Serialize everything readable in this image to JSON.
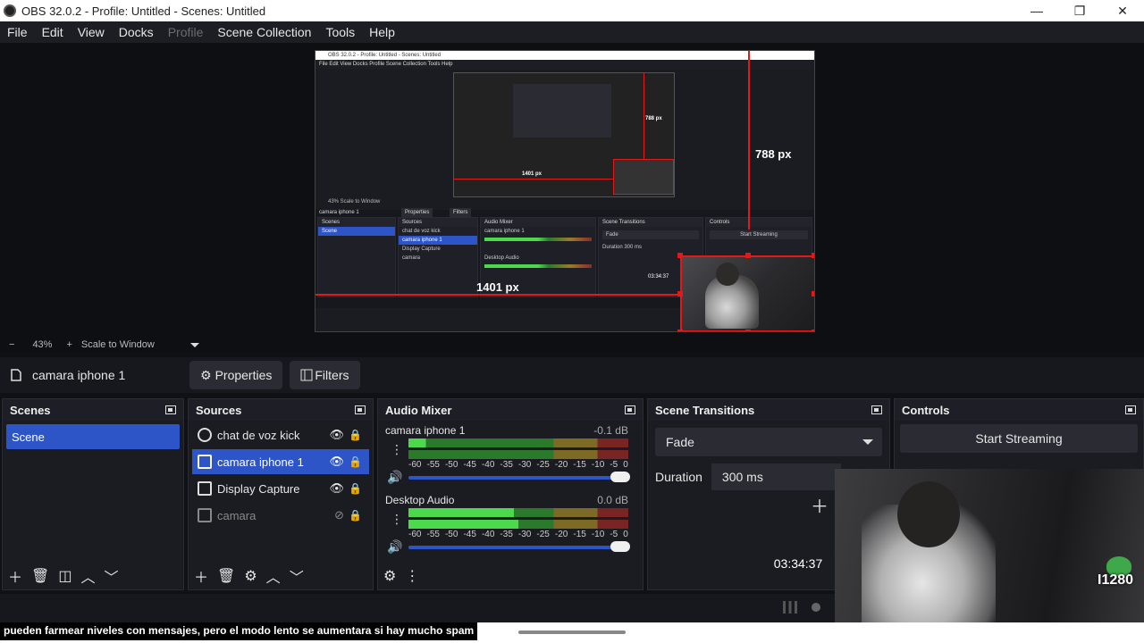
{
  "window": {
    "title": "OBS 32.0.2 - Profile: Untitled - Scenes: Untitled",
    "minimize": "—",
    "maximize": "❐",
    "close": "✕"
  },
  "menu": [
    "File",
    "Edit",
    "View",
    "Docks",
    "Profile",
    "Scene Collection",
    "Tools",
    "Help"
  ],
  "preview": {
    "measure_vertical": "788 px",
    "measure_horizontal": "1401 px",
    "mini_title": "OBS 32.0.2 - Profile: Untitled - Scenes: Untitled",
    "mini_menu": "File  Edit  View  Docks  Profile  Scene Collection  Tools  Help",
    "mini_measure_v": "788 px",
    "mini_measure_h": "1401 px",
    "mini_timer": "03:34:37",
    "mini_zoom": "43%   Scale to Window",
    "mini_source_name": "camara iphone 1",
    "mini_props": "Properties",
    "mini_filters": "Filters",
    "mini_scenes_header": "Scenes",
    "mini_scene": "Scene",
    "mini_sources_header": "Sources",
    "mini_sources": [
      "chat de voz kick",
      "camara iphone 1",
      "Display Capture",
      "camara"
    ],
    "mini_mixer_header": "Audio Mixer",
    "mini_mixer_ch1": "camara iphone 1",
    "mini_mixer_ch2": "Desktop Audio",
    "mini_trans_header": "Scene Transitions",
    "mini_trans_value": "Fade",
    "mini_duration": "Duration   300 ms",
    "mini_controls_header": "Controls",
    "mini_start": "Start Streaming"
  },
  "zoom": {
    "minus": "−",
    "level": "43%",
    "plus": "+",
    "mode": "Scale to Window"
  },
  "source_toolbar": {
    "name": "camara iphone 1",
    "properties": "Properties",
    "filters": "Filters"
  },
  "scenes": {
    "header": "Scenes",
    "items": [
      "Scene"
    ]
  },
  "sources": {
    "header": "Sources",
    "items": [
      {
        "label": "chat de voz kick",
        "icon": "globe-icon",
        "visible": true
      },
      {
        "label": "camara iphone 1",
        "icon": "file-icon",
        "visible": true
      },
      {
        "label": "Display Capture",
        "icon": "monitor-icon",
        "visible": true
      },
      {
        "label": "camara",
        "icon": "video-icon",
        "visible": false
      }
    ]
  },
  "mixer": {
    "header": "Audio Mixer",
    "channels": [
      {
        "name": "camara iphone 1",
        "db": "-0.1 dB"
      },
      {
        "name": "Desktop Audio",
        "db": "0.0 dB"
      }
    ],
    "ticks": [
      "-60",
      "-55",
      "-50",
      "-45",
      "-40",
      "-35",
      "-30",
      "-25",
      "-20",
      "-15",
      "-10",
      "-5",
      "0"
    ]
  },
  "transitions": {
    "header": "Scene Transitions",
    "selected": "Fade",
    "duration_label": "Duration",
    "duration_value": "300 ms"
  },
  "controls": {
    "header": "Controls",
    "start_streaming": "Start Streaming"
  },
  "status": {
    "timer": "03:34:37"
  },
  "overlay": {
    "caption": "pueden farmear niveles con mensajes, pero el modo lento se aumentara si hay mucho spam",
    "badge_text": "I1280"
  },
  "colors": {
    "accent": "#2d55c8",
    "selection_red": "#e01919"
  }
}
